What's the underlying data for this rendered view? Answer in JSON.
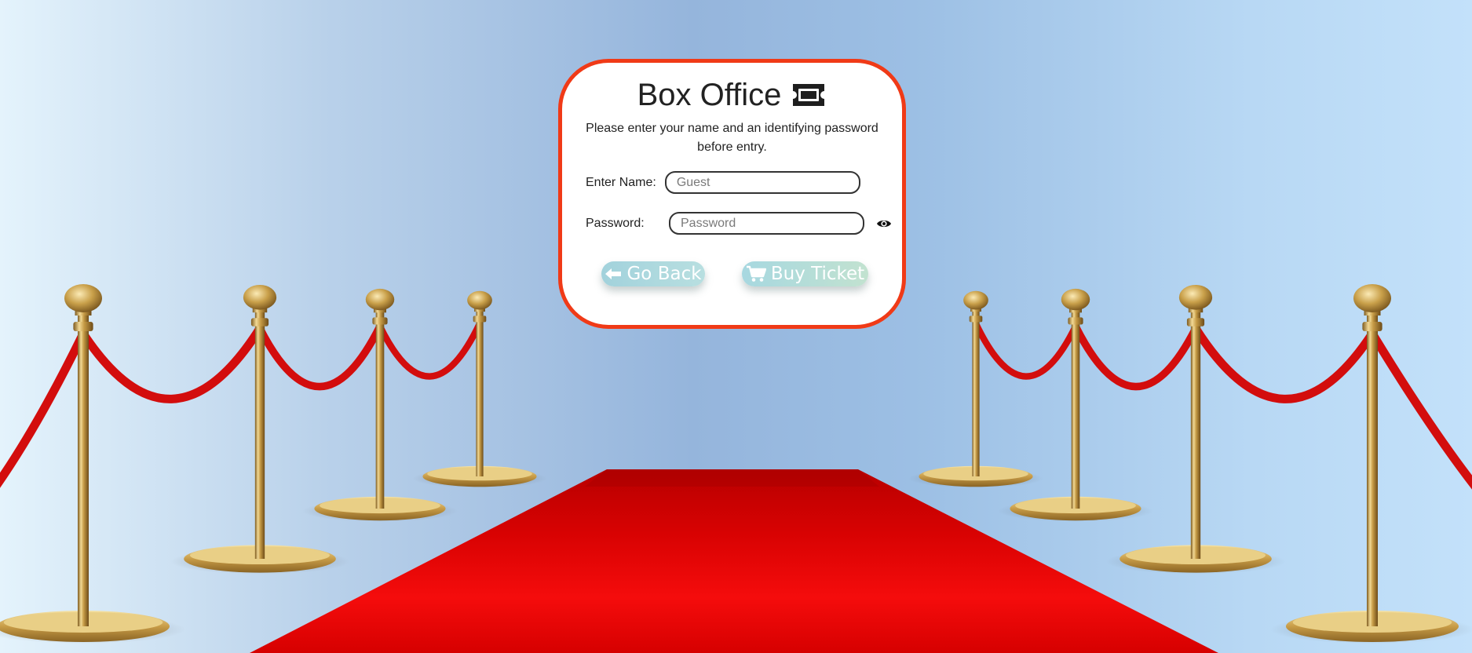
{
  "card": {
    "title": "Box Office",
    "title_icon": "ticket-icon",
    "intro": "Please enter your name and an identifying password before entry.",
    "name_label": "Enter Name:",
    "name_value": "",
    "name_placeholder": "Guest",
    "password_label": "Password:",
    "password_value": "",
    "password_placeholder": "Password",
    "password_toggle_icon": "eye-icon",
    "back_button": {
      "label": "Go Back",
      "icon": "arrow-left-icon"
    },
    "buy_button": {
      "label": "Buy Ticket",
      "icon": "shopping-cart-icon"
    }
  },
  "background": {
    "description_icons": [
      "red-carpet",
      "brass-stanchions",
      "red-velvet-ropes"
    ]
  },
  "colors": {
    "card_border": "#f03a17",
    "carpet_red": "#e10000",
    "rope_red": "#d10c0c",
    "brass": "#c9a24e"
  }
}
